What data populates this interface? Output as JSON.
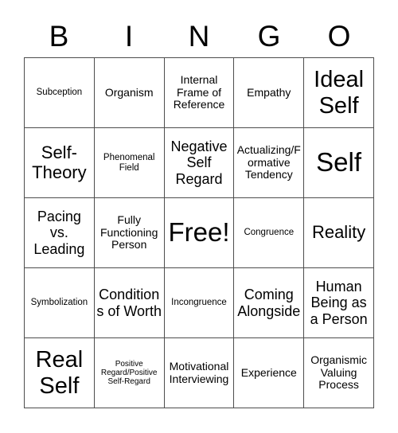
{
  "card": {
    "title": "Bingo Card",
    "header_letters": [
      "B",
      "I",
      "N",
      "G",
      "O"
    ],
    "grid": {
      "columns": 5,
      "rows": 5,
      "border_color": "#4d4d4d",
      "background_color": "#ffffff",
      "text_color": "#000000"
    },
    "cells": [
      [
        {
          "text": "Subception",
          "size": "sz-s"
        },
        {
          "text": "Organism",
          "size": "sz-m"
        },
        {
          "text": "Internal Frame of Reference",
          "size": "sz-m"
        },
        {
          "text": "Empathy",
          "size": "sz-m"
        },
        {
          "text": "Ideal Self",
          "size": "sz-xxl"
        }
      ],
      [
        {
          "text": "Self-Theory",
          "size": "sz-xl"
        },
        {
          "text": "Phenomenal Field",
          "size": "sz-s"
        },
        {
          "text": "Negative Self Regard",
          "size": "sz-l"
        },
        {
          "text": "Actualizing/Formative Tendency",
          "size": "sz-m"
        },
        {
          "text": "Self",
          "size": "sz-huge"
        }
      ],
      [
        {
          "text": "Pacing vs. Leading",
          "size": "sz-l"
        },
        {
          "text": "Fully Functioning Person",
          "size": "sz-m"
        },
        {
          "text": "Free!",
          "size": "sz-huge"
        },
        {
          "text": "Congruence",
          "size": "sz-s"
        },
        {
          "text": "Reality",
          "size": "sz-xl"
        }
      ],
      [
        {
          "text": "Symbolization",
          "size": "sz-s"
        },
        {
          "text": "Conditions of Worth",
          "size": "sz-l"
        },
        {
          "text": "Incongruence",
          "size": "sz-s"
        },
        {
          "text": "Coming Alongside",
          "size": "sz-l"
        },
        {
          "text": "Human Being as a Person",
          "size": "sz-l"
        }
      ],
      [
        {
          "text": "Real Self",
          "size": "sz-xxl"
        },
        {
          "text": "Positive Regard/Positive Self-Regard",
          "size": "sz-xs"
        },
        {
          "text": "Motivational Interviewing",
          "size": "sz-m"
        },
        {
          "text": "Experience",
          "size": "sz-m"
        },
        {
          "text": "Organismic Valuing Process",
          "size": "sz-m"
        }
      ]
    ]
  }
}
